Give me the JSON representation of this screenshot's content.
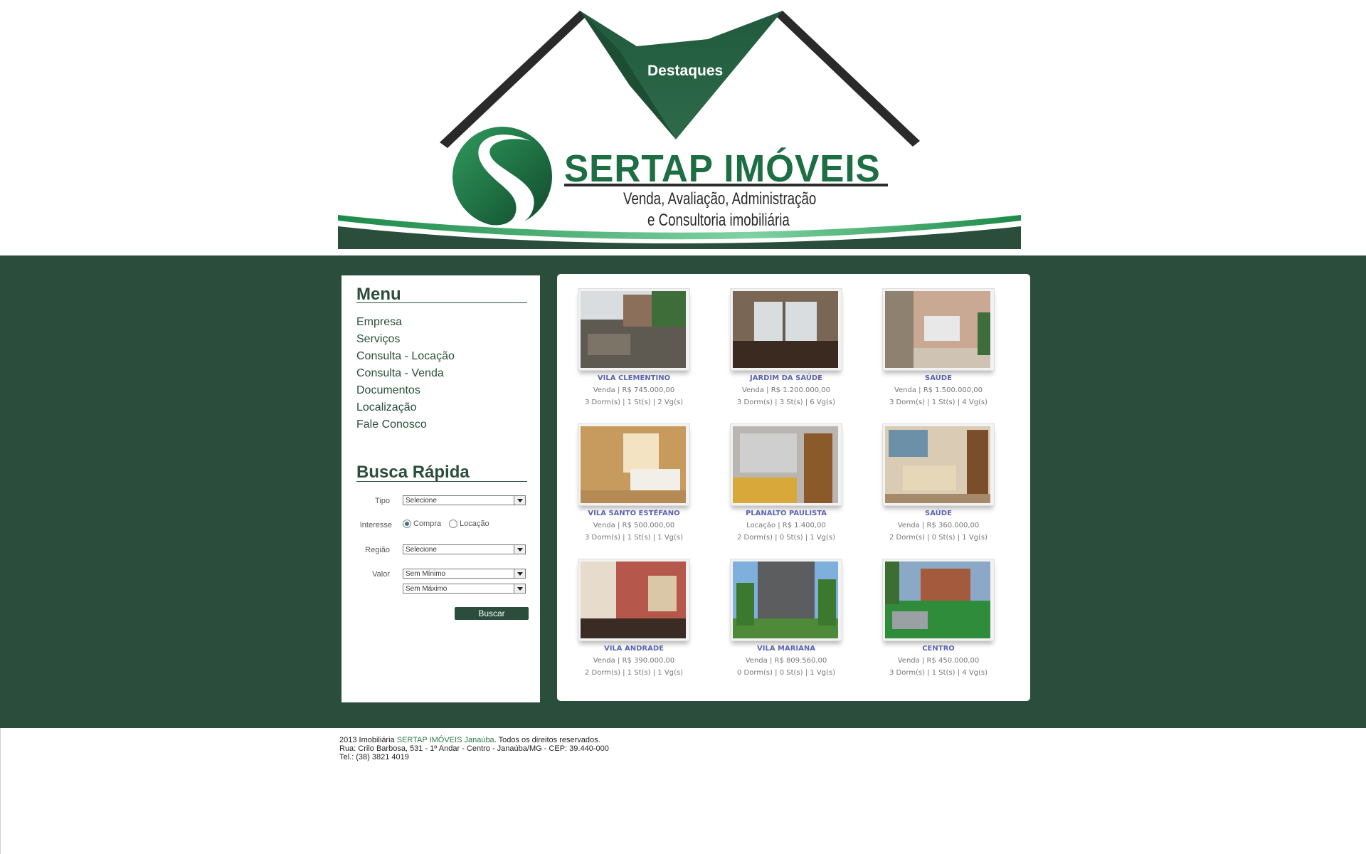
{
  "header": {
    "highlight_label": "Destaques",
    "brand_name": "SERTAP IMÓVEIS",
    "tagline_line1": "Venda, Avaliação, Administração",
    "tagline_line2": "e Consultoria imobiliária"
  },
  "menu": {
    "title": "Menu",
    "items": [
      {
        "label": "Empresa"
      },
      {
        "label": "Serviços"
      },
      {
        "label": "Consulta - Locação"
      },
      {
        "label": "Consulta - Venda"
      },
      {
        "label": "Documentos"
      },
      {
        "label": "Localização"
      },
      {
        "label": "Fale Conosco"
      }
    ]
  },
  "search": {
    "title": "Busca Rápida",
    "tipo_label": "Tipo",
    "tipo_value": "Selecione",
    "interesse_label": "Interesse",
    "interesse_options": [
      "Compra",
      "Locação"
    ],
    "interesse_selected": "Compra",
    "regiao_label": "Região",
    "regiao_value": "Selecione",
    "valor_label": "Valor",
    "valor_min": "Sem Mínimo",
    "valor_max": "Sem Máximo",
    "submit_label": "Buscar"
  },
  "listings": [
    {
      "name": "VILA CLEMENTINO",
      "price": "Venda | R$ 745.000,00",
      "specs": "3 Dorm(s) | 1 St(s) | 2 Vg(s)"
    },
    {
      "name": "JARDIM DA SAÚDE",
      "price": "Venda | R$ 1.200.000,00",
      "specs": "3 Dorm(s) | 3 St(s) | 6 Vg(s)"
    },
    {
      "name": "SAÚDE",
      "price": "Venda | R$ 1.500.000,00",
      "specs": "3 Dorm(s) | 1 St(s) | 4 Vg(s)"
    },
    {
      "name": "VILA SANTO ESTÉFANO",
      "price": "Venda | R$ 500.000,00",
      "specs": "3 Dorm(s) | 1 St(s) | 1 Vg(s)"
    },
    {
      "name": "PLANALTO PAULISTA",
      "price": "Locação | R$ 1.400,00",
      "specs": "2 Dorm(s) | 0 St(s) | 1 Vg(s)"
    },
    {
      "name": "SAÚDE",
      "price": "Venda | R$ 360.000,00",
      "specs": "2 Dorm(s) | 0 St(s) | 1 Vg(s)"
    },
    {
      "name": "VILA ANDRADE",
      "price": "Venda | R$ 390.000,00",
      "specs": "2 Dorm(s) | 1 St(s) | 1 Vg(s)"
    },
    {
      "name": "VILA MARIANA",
      "price": "Venda | R$ 809.560,00",
      "specs": "0 Dorm(s) | 0 St(s) | 1 Vg(s)"
    },
    {
      "name": "CENTRO",
      "price": "Venda | R$ 450.000,00",
      "specs": "3 Dorm(s) | 1 St(s) | 4 Vg(s)"
    }
  ],
  "footer": {
    "copyright_prefix": "2013 Imobiliária ",
    "company_link": "SERTAP IMÓVEIS Janaúba",
    "copyright_suffix": ". Todos os direitos reservados.",
    "address": "Rua: Crilo Barbosa, 531 - 1º Andar - Centro - Janaúba/MG - CEP: 39.440-000",
    "phone": "Tel.: (38) 3821 4019"
  },
  "colors": {
    "brand_green": "#2a4d3c",
    "logo_green": "#1d6f43",
    "listing_title": "#5a63b0"
  }
}
